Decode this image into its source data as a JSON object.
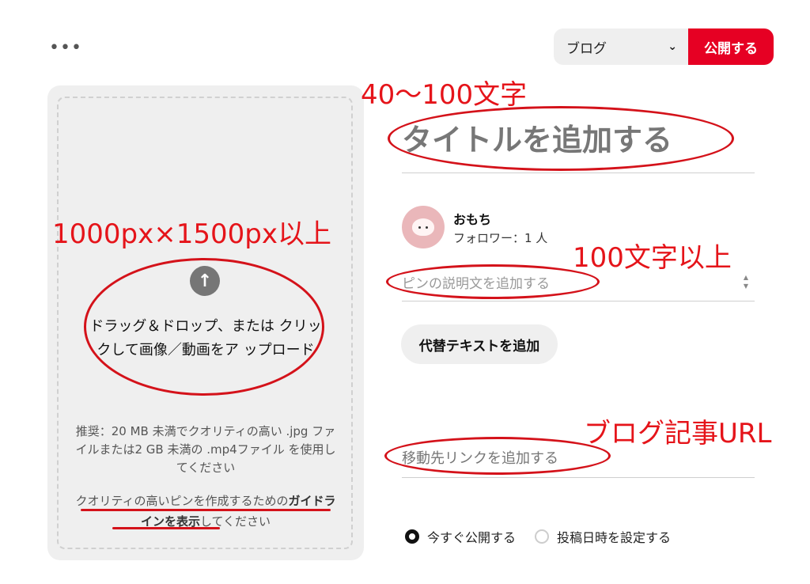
{
  "header": {
    "more_icon": "more-horizontal-icon",
    "more_text": "•••",
    "board_select": {
      "value": "ブログ",
      "icon": "chevron-down-icon",
      "chevron": "⌄"
    },
    "publish_label": "公開する"
  },
  "upload": {
    "icon": "upload-arrow-icon",
    "arrow": "↑",
    "text": "ドラッグ＆ドロップ、または クリックして画像／動画をア ップロード",
    "recommendation": "推奨：20 MB 未満でクオリティの高い .jpg ファイルまたは2 GB 未満の .mp4ファイル を使用してください",
    "guide_prefix": "クオリティの高いピンを作成するための",
    "guide_link": "ガイドラインを表示",
    "guide_suffix": "してください"
  },
  "form": {
    "title_placeholder": "タイトルを追加する",
    "user_name": "おもち",
    "followers": "フォロワー：1 人",
    "description_placeholder": "ピンの説明文を追加する",
    "spinner_up": "▲",
    "spinner_down": "▼",
    "alt_text_button": "代替テキストを追加",
    "link_placeholder": "移動先リンクを追加する",
    "publish_options": [
      {
        "label": "今すぐ公開する",
        "selected": true
      },
      {
        "label": "投稿日時を設定する",
        "selected": false
      }
    ]
  },
  "annotations": {
    "title_chars": "40〜100文字",
    "image_size": "1000px×1500px以上",
    "desc_chars": "100文字以上",
    "link_note": "ブログ記事URL",
    "color": "#e5141a"
  }
}
